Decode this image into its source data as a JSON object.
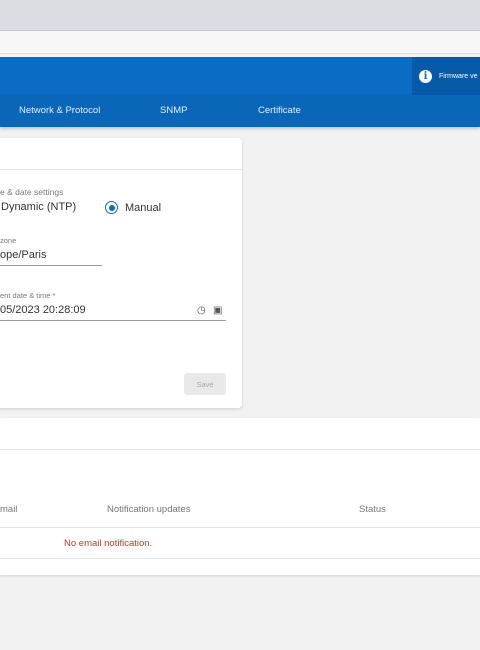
{
  "header": {
    "info_text": "Firmware ve"
  },
  "nav": {
    "tabs": [
      {
        "label": "Network & Protocol"
      },
      {
        "label": "SNMP"
      },
      {
        "label": "Certificate"
      }
    ]
  },
  "datetime": {
    "settings_label": "e & date settings",
    "option_dynamic": "Dynamic (NTP)",
    "option_manual": "Manual",
    "selected": "Manual",
    "timezone_label": "zone",
    "timezone_value": "ope/Paris",
    "current_label": "ent date & time *",
    "current_value": "05/2023 20:28:09",
    "save_label": "Save"
  },
  "email": {
    "columns": [
      "mail",
      "Notification updates",
      "Status"
    ],
    "empty_message": "No email notification."
  },
  "colors": {
    "header_blue": "#0a6cc2",
    "accent": "#0a6cc2",
    "error": "#c0392b"
  }
}
